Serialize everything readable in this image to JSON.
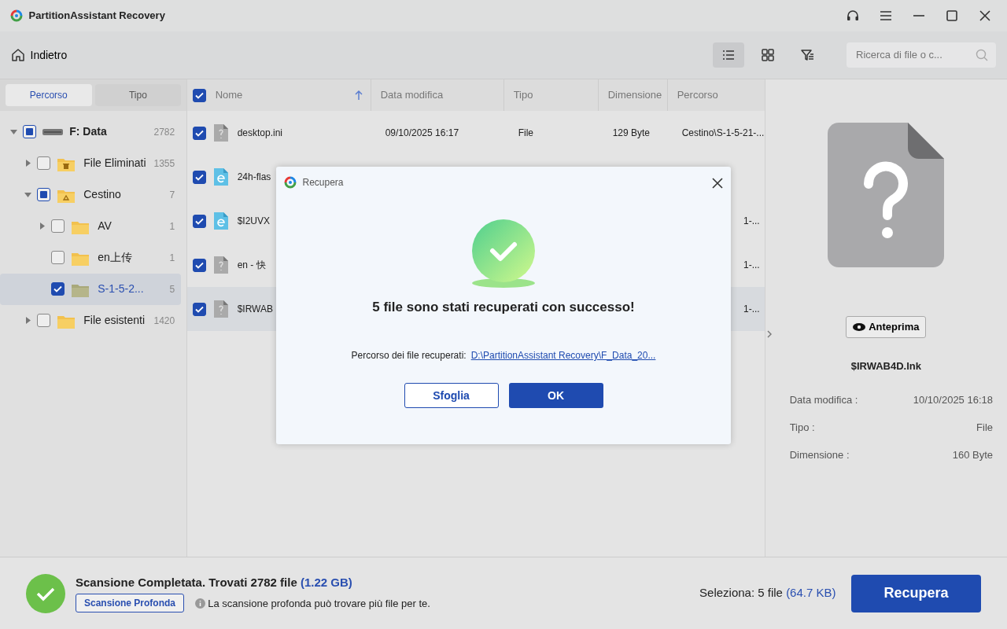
{
  "window": {
    "title": "PartitionAssistant Recovery"
  },
  "toolbar": {
    "back": "Indietro",
    "views": [
      {
        "kind": "list",
        "selected": true
      },
      {
        "kind": "grid",
        "selected": false
      },
      {
        "kind": "filter",
        "selected": false
      }
    ],
    "search": {
      "placeholder": "Ricerca di file o c..."
    }
  },
  "sidebar": {
    "tabs": [
      {
        "label": "Percorso",
        "selected": true
      },
      {
        "label": "Tipo",
        "selected": false
      }
    ],
    "tree": [
      {
        "kind": "drive",
        "label": "F: Data",
        "count": "2782",
        "checked": false,
        "indeterminate": true,
        "expanded": true,
        "selected": false,
        "children": [
          {
            "kind": "trash",
            "label": "File Eliminati",
            "count": "1355",
            "checked": false,
            "expanded": false,
            "selected": false
          },
          {
            "kind": "recycle",
            "label": "Cestino",
            "count": "7",
            "checked": false,
            "indeterminate": true,
            "expanded": true,
            "selected": false,
            "children": [
              {
                "kind": "folder",
                "label": "AV",
                "count": "1",
                "checked": false,
                "expanded": false,
                "selected": false
              },
              {
                "kind": "folder",
                "label": "en上传",
                "count": "1",
                "checked": false,
                "selected": false
              },
              {
                "kind": "special",
                "label": "S-1-5-2...",
                "count": "5",
                "checked": true,
                "selected": true
              }
            ]
          },
          {
            "kind": "folder",
            "label": "File esistenti",
            "count": "1420",
            "checked": false,
            "expanded": false,
            "selected": false
          }
        ]
      }
    ]
  },
  "table": {
    "all_checked": true,
    "columns": [
      {
        "label": "Nome",
        "sorted": true
      },
      {
        "label": "Data modifica",
        "sorted": false
      },
      {
        "label": "Tipo",
        "sorted": false
      },
      {
        "label": "Dimensione",
        "sorted": false
      },
      {
        "label": "Percorso",
        "sorted": false
      }
    ],
    "rows": [
      {
        "kind": "unknown",
        "checked": true,
        "selected": false,
        "cells": [
          "desktop.ini",
          "09/10/2025 16:17",
          "File",
          "129 Byte",
          "Cestino\\S-1-5-21-..."
        ]
      },
      {
        "kind": "web",
        "checked": true,
        "selected": false,
        "cells": [
          "24h-flas",
          null,
          null,
          null,
          null
        ]
      },
      {
        "kind": "web",
        "checked": true,
        "selected": false,
        "cells": [
          "$I2UVX",
          null,
          null,
          null,
          "1-..."
        ]
      },
      {
        "kind": "unknown",
        "checked": true,
        "selected": false,
        "cells": [
          "en - 快",
          null,
          null,
          null,
          "1-..."
        ]
      },
      {
        "kind": "unknown",
        "checked": true,
        "selected": true,
        "cells": [
          "$IRWAB",
          null,
          null,
          null,
          "1-..."
        ]
      }
    ]
  },
  "details": {
    "preview_button": "Anteprima",
    "filename": "$IRWAB4D.lnk",
    "fields": [
      {
        "label": "Data modifica :",
        "value": "10/10/2025 16:18"
      },
      {
        "label": "Tipo :",
        "value": "File"
      },
      {
        "label": "Dimensione :",
        "value": "160 Byte"
      }
    ]
  },
  "dialog": {
    "title": "Recupera",
    "message": "5 file sono stati recuperati con successo!",
    "path_label": "Percorso dei file recuperati:",
    "path_link": "D:\\PartitionAssistant Recovery\\F_Data_20...",
    "buttons": [
      {
        "label": "Sfoglia",
        "kind": "secondary"
      },
      {
        "label": "OK",
        "kind": "primary"
      }
    ]
  },
  "status_bar": {
    "summary": "Scansione Completata. Trovati 2782 file",
    "size": "(1.22 GB)",
    "deep_scan_button": "Scansione Profonda",
    "hint": "La scansione profonda può trovare più file per te.",
    "selection": "Seleziona: 5 file",
    "selection_size": "(64.7 KB)",
    "recover_button": "Recupera"
  }
}
